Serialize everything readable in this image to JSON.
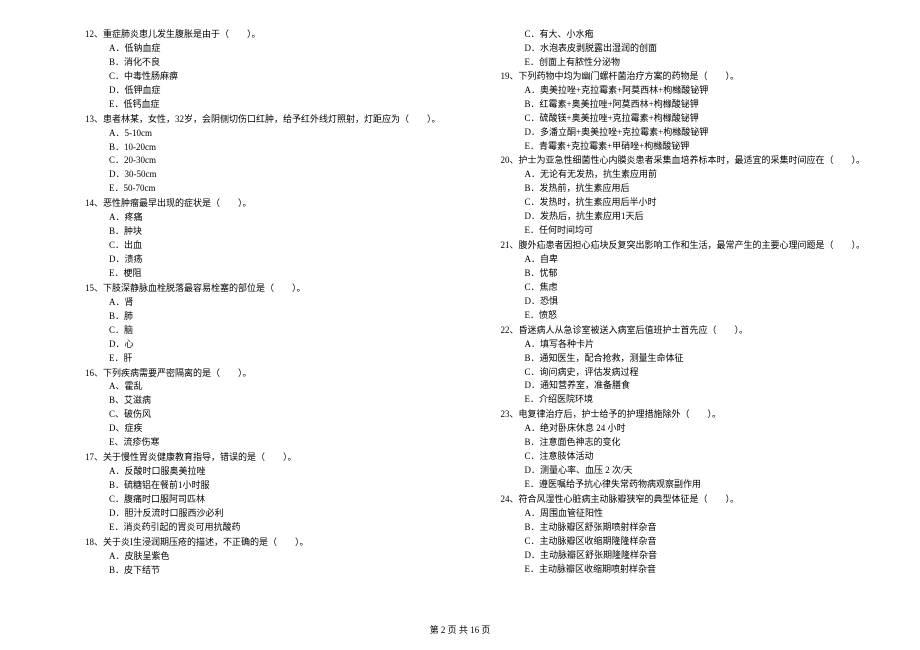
{
  "footer": "第 2 页 共 16 页",
  "left": [
    {
      "title": "12、重症肺炎患儿发生腹胀是由于（　　）。",
      "opts": [
        "A．低钠血症",
        "B．消化不良",
        "C．中毒性肠麻痹",
        "D．低钾血症",
        "E．低钙血症"
      ]
    },
    {
      "title": "13、患者林某，女性，32岁，会阴侧切伤口红肿，给予红外线灯照射，灯距应为（　　）。",
      "opts": [
        "A．5-10cm",
        "B．10-20cm",
        "C．20-30cm",
        "D．30-50cm",
        "E．50-70cm"
      ]
    },
    {
      "title": "14、恶性肿瘤最早出现的症状是（　　）。",
      "opts": [
        "A．疼痛",
        "B．肿块",
        "C．出血",
        "D．溃疡",
        "E．梗阻"
      ]
    },
    {
      "title": "15、下肢深静脉血栓脱落最容易栓塞的部位是（　　）。",
      "opts": [
        "A．肾",
        "B．肺",
        "C．脑",
        "D．心",
        "E．肝"
      ]
    },
    {
      "title": "16、下列疾病需要严密隔离的是（　　）。",
      "opts": [
        "A、霍乱",
        "B、艾滋病",
        "C、破伤风",
        "D、症疾",
        "E、流疹伤寒"
      ]
    },
    {
      "title": "17、关于慢性胃炎健康教育指导，错误的是（　　）。",
      "opts": [
        "A．反酸时口服奥美拉唑",
        "B．硫糖铝在餐前1小时服",
        "C．腹痛时口服阿司匹林",
        "D．胆汁反流时口服西沙必利",
        "E．消炎药引起的胃炎可用抗酸药"
      ]
    },
    {
      "title": "18、关于炎I生浸润期压疮的描述，不正确的是（　　）。",
      "opts": [
        "A．皮肤呈紫色",
        "B．皮下结节"
      ]
    }
  ],
  "right_pre": [
    "C．有大、小水疱",
    "D．水泡表皮剥脱露出湿润的创面",
    "E．创面上有脓性分泌物"
  ],
  "right": [
    {
      "title": "19、下列药物中均为幽门螺杆菌治疗方案的药物是（　　）。",
      "opts": [
        "A．奥美拉唑+克拉霉素+阿莫西林+枸橼酸铋钾",
        "B．红霉素+奥美拉唑+阿莫西林+枸橼酸铋钾",
        "C．硫酸镁+奥美拉唑+克拉霉素+枸橼酸铋钾",
        "D．多潘立酮+奥美拉唑+克拉霉素+枸橼酸铋钾",
        "E．青霉素+克拉霉素+甲硝唑+枸橼酸铋钾"
      ]
    },
    {
      "title": "20、护士为亚急性细菌性心内膜炎患者采集血培养标本时，最适宜的采集时间应在（　　）。",
      "opts": [
        "A．无论有无发热，抗生素应用前",
        "B．发热前，抗生素应用后",
        "C．发热时，抗生素应用后半小时",
        "D．发热后，抗生素应用1天后",
        "E．任何时间均可"
      ]
    },
    {
      "title": "21、腹外疝患者因担心疝块反复突出影响工作和生活，最常产生的主要心理问题是（　　）。",
      "opts": [
        "A．自卑",
        "B．忧郁",
        "C．焦虑",
        "D．恐惧",
        "E．愤怒"
      ]
    },
    {
      "title": "22、昏迷病人从急诊室被送入病室后值班护士首先应（　　）。",
      "opts": [
        "A．填写各种卡片",
        "B．通知医生，配合抢救，测量生命体征",
        "C．询问病史，评估发病过程",
        "D．通知营养室，准备膳食",
        "E．介绍医院环境"
      ]
    },
    {
      "title": "23、电复律治疗后，护士给予的护理措施除外（　　）。",
      "opts": [
        "A．绝对卧床休息 24 小时",
        "B．注意面色神志的变化",
        "C．注意肢体活动",
        "D．测量心率、血压 2 次/天",
        "E．遵医嘱给予抗心律失常药物病观察副作用"
      ]
    },
    {
      "title": "24、符合风湿性心脏病主动脉瓣狭窄的典型体征是（　　）。",
      "opts": [
        "A．周围血管征阳性",
        "B．主动脉瓣区舒张期喷射样杂音",
        "C．主动脉瓣区收缩期隆隆样杂音",
        "D．主动脉瓣区舒张期隆隆样杂音",
        "E．主动脉瓣区收缩期喷射样杂音"
      ]
    }
  ]
}
